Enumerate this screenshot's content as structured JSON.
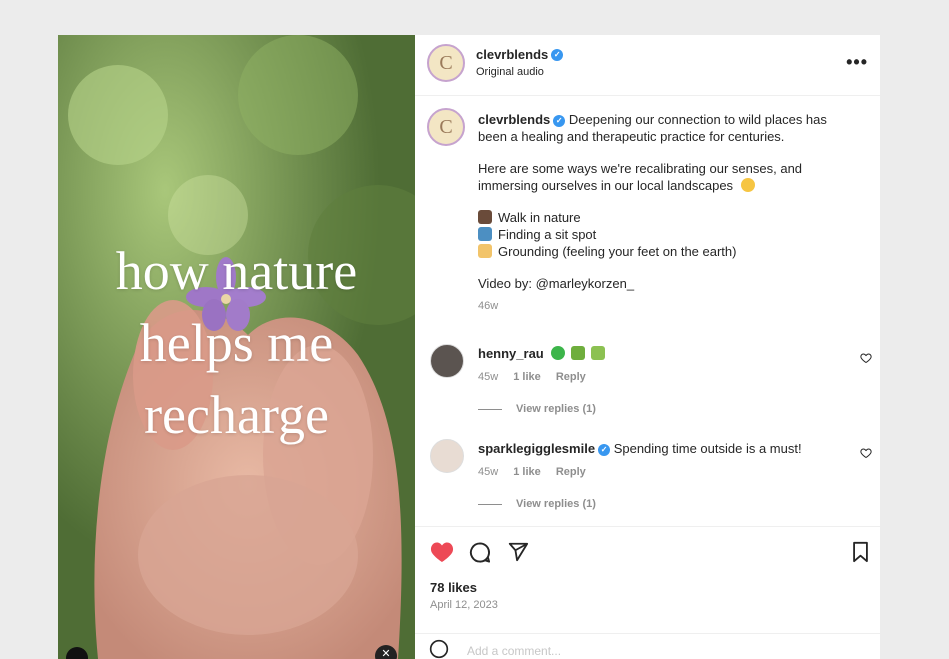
{
  "media": {
    "overlay_lines": [
      "how nature",
      "helps me",
      "recharge"
    ]
  },
  "header": {
    "username": "clevrblends",
    "subtitle": "Original audio",
    "avatar_letter": "C"
  },
  "caption": {
    "username": "clevrblends",
    "text_p1": "Deepening our connection to wild places has been a healing and therapeutic practice for centuries.",
    "text_p2": "Here are some ways we're recalibrating our senses, and immersing ourselves in our local landscapes",
    "list": [
      {
        "icon": "boot-emoji",
        "text": "Walk in nature"
      },
      {
        "icon": "landscape-emoji",
        "text": "Finding a sit spot"
      },
      {
        "icon": "foot-emoji",
        "text": "Grounding (feeling your feet on the earth)"
      }
    ],
    "credit_label": "Video by:",
    "credit_handle": "@marleykorzen_",
    "age": "46w"
  },
  "comments": [
    {
      "username": "henny_rau",
      "text": "",
      "age": "45w",
      "likes": "1 like",
      "reply": "Reply",
      "view_replies": "View replies (1)"
    },
    {
      "username": "sparklegigglesmile",
      "text": "Spending time outside is a must!",
      "age": "45w",
      "likes": "1 like",
      "reply": "Reply",
      "view_replies": "View replies (1)"
    }
  ],
  "footer": {
    "likes": "78 likes",
    "date": "April 12, 2023",
    "add_comment_placeholder": "Add a comment..."
  },
  "colors": {
    "heart": "#ed4956",
    "verified": "#3897f0",
    "muted": "#8e8e8e"
  }
}
